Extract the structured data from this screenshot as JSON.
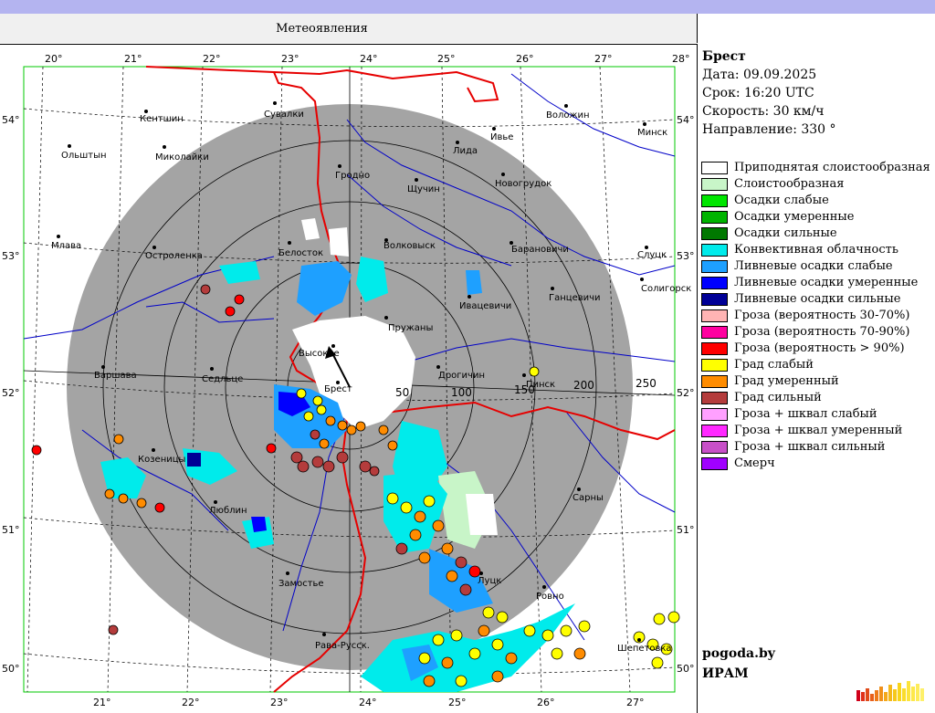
{
  "window": {
    "title": "Метеоявления"
  },
  "info": {
    "station": "Брест",
    "date": "Дата: 09.09.2025",
    "time": "Срок: 16:20 UTC",
    "speed": "Скорость: 30  км/ч",
    "direction": "Направление: 330 °"
  },
  "legend": [
    {
      "label": "Приподнятая слоистообразная",
      "color": "#ffffff"
    },
    {
      "label": "Слоистообразная",
      "color": "#c8f5c8"
    },
    {
      "label": "Осадки слабые",
      "color": "#00e600"
    },
    {
      "label": "Осадки умеренные",
      "color": "#00b400"
    },
    {
      "label": "Осадки сильные",
      "color": "#007800"
    },
    {
      "label": "Конвективная облачность",
      "color": "#00ebeb"
    },
    {
      "label": "Ливневые осадки слабые",
      "color": "#1ea0ff"
    },
    {
      "label": "Ливневые осадки умеренные",
      "color": "#0000ff"
    },
    {
      "label": "Ливневые осадки сильные",
      "color": "#000096"
    },
    {
      "label": "Гроза (вероятность 30-70%)",
      "color": "#ffb4b4"
    },
    {
      "label": "Гроза (вероятность 70-90%)",
      "color": "#ff00a0"
    },
    {
      "label": "Гроза (вероятность > 90%)",
      "color": "#ff0000"
    },
    {
      "label": "Град слабый",
      "color": "#ffff00"
    },
    {
      "label": "Град умеренный",
      "color": "#ff8c00"
    },
    {
      "label": "Град сильный",
      "color": "#b43c3c"
    },
    {
      "label": "Гроза + шквал слабый",
      "color": "#ffa0ff"
    },
    {
      "label": "Гроза + шквал умеренный",
      "color": "#ff28ff"
    },
    {
      "label": "Гроза + шквал сильный",
      "color": "#c850c8"
    },
    {
      "label": "Смерч",
      "color": "#a000ff"
    }
  ],
  "footer": {
    "site": "pogoda.by",
    "org": "ИРАМ"
  },
  "map": {
    "lon_labels_top": [
      "20°",
      "21°",
      "22°",
      "23°",
      "24°",
      "25°",
      "26°",
      "27°",
      "28°"
    ],
    "lon_labels_bottom": [
      "21°",
      "22°",
      "23°",
      "24°",
      "25°",
      "26°",
      "27°"
    ],
    "lat_labels_left": [
      "54°",
      "53°",
      "52°",
      "51°",
      "50°"
    ],
    "lat_labels_right": [
      "54°",
      "53°",
      "52°",
      "51°",
      "50°"
    ],
    "range_labels": [
      "50",
      "100",
      "150",
      "200",
      "250"
    ],
    "cities": [
      {
        "name": "Кентшин"
      },
      {
        "name": "Сувалки"
      },
      {
        "name": "Воложин"
      },
      {
        "name": "Минск"
      },
      {
        "name": "Ольштын"
      },
      {
        "name": "Миколайки"
      },
      {
        "name": "Ивье"
      },
      {
        "name": "Лида"
      },
      {
        "name": "Гродно"
      },
      {
        "name": "Щучин"
      },
      {
        "name": "Новогрудок"
      },
      {
        "name": "Млава"
      },
      {
        "name": "Остроленка"
      },
      {
        "name": "Белосток"
      },
      {
        "name": "Волковыск"
      },
      {
        "name": "Барановичи"
      },
      {
        "name": "Слуцк"
      },
      {
        "name": "Ивацевичи"
      },
      {
        "name": "Ганцевичи"
      },
      {
        "name": "Солигорск"
      },
      {
        "name": "Пружаны"
      },
      {
        "name": "Высокое"
      },
      {
        "name": "Варшава"
      },
      {
        "name": "Седльце"
      },
      {
        "name": "Брест"
      },
      {
        "name": "Дрогичин"
      },
      {
        "name": "Пинск"
      },
      {
        "name": "Козеницы"
      },
      {
        "name": "Люблин"
      },
      {
        "name": "Сарны"
      },
      {
        "name": "Замостье"
      },
      {
        "name": "Луцк"
      },
      {
        "name": "Ровно"
      },
      {
        "name": "Рава-Русск."
      },
      {
        "name": "Шепетовка"
      }
    ]
  },
  "colors": {
    "radar_disk": "#a4a4a4",
    "border": "#e60000",
    "river": "#0000c8",
    "frame": "#00c800"
  }
}
